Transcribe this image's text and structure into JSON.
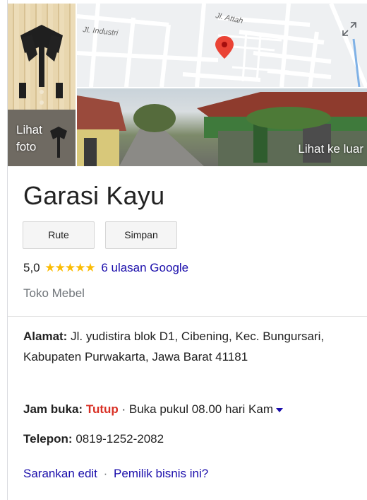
{
  "media": {
    "photo_label": "Lihat foto",
    "street_view_label": "Lihat ke luar",
    "map_streets": [
      "Jl. Industri",
      "Jl. Attah"
    ]
  },
  "place": {
    "name": "Garasi Kayu",
    "category": "Toko Mebel"
  },
  "actions": {
    "route_label": "Rute",
    "save_label": "Simpan"
  },
  "rating": {
    "score": "5,0",
    "stars": "★★★★★",
    "reviews_label": "6 ulasan Google"
  },
  "details": {
    "address_label": "Alamat:",
    "address_value": "Jl. yudistira blok D1, Cibening, Kec. Bungursari, Kabupaten Purwakarta, Jawa Barat 41181",
    "hours_label": "Jam buka:",
    "hours_status": "Tutup",
    "hours_text": "· Buka pukul 08.00 hari Kam",
    "phone_label": "Telepon:",
    "phone_value": "0819-1252-2082"
  },
  "footer_links": {
    "suggest_edit": "Sarankan edit",
    "separator": "·",
    "owner": "Pemilik bisnis ini?"
  },
  "colors": {
    "link": "#1a0dab",
    "closed": "#d93025",
    "star": "#fbbc04",
    "pin": "#ea4335"
  }
}
